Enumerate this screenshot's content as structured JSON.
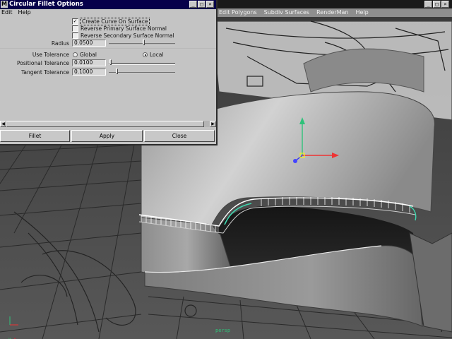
{
  "app": {
    "menus": [
      "Edit Polygons",
      "Subdiv Surfaces",
      "RenderMan",
      "Help"
    ]
  },
  "dialog": {
    "title": "Circular Fillet Options",
    "menus": [
      "Edit",
      "Help"
    ],
    "checkboxes": [
      {
        "label": "Create Curve On Surface",
        "checked": true
      },
      {
        "label": "Reverse Primary Surface Normal",
        "checked": false
      },
      {
        "label": "Reverse Secondary Surface Normal",
        "checked": false
      }
    ],
    "radius": {
      "label": "Radius",
      "value": "0.0500",
      "slider_fraction": 0.53
    },
    "use_tolerance": {
      "label": "Use Tolerance",
      "options": [
        "Global",
        "Local"
      ],
      "selected": "Local"
    },
    "positional_tolerance": {
      "label": "Positional Tolerance",
      "value": "0.0100",
      "slider_fraction": 0.01
    },
    "tangent_tolerance": {
      "label": "Tangent Tolerance",
      "value": "0.1000",
      "slider_fraction": 0.1
    },
    "buttons": {
      "fillet": "Fillet",
      "apply": "Apply",
      "close": "Close"
    }
  },
  "window_controls": {
    "minimize": "_",
    "maximize": "□",
    "close": "×"
  },
  "viewport": {
    "axis_x": "x",
    "axis_y": "y"
  }
}
